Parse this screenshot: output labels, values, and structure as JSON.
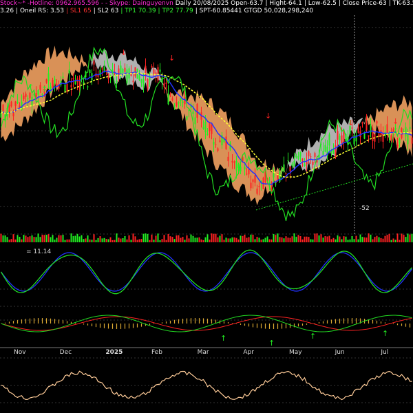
{
  "header": {
    "line1": [
      {
        "text": "Stock~* -Hotline: 0962.965.596 - - Skype: Dainguyenvn",
        "color": "#ff2bd6"
      },
      {
        "text": "Daily 20/08/2025 Open-63.7",
        "color": "#ffffff"
      },
      {
        "text": "| Hight-64.1",
        "color": "#ffffff"
      },
      {
        "text": "| Low-62.5",
        "color": "#ffffff"
      },
      {
        "text": "| Close Price-63",
        "color": "#ffffff"
      },
      {
        "text": "| TK-63.5| KJ-65.15931",
        "color": "#ffffff"
      }
    ],
    "line2": [
      {
        "text": "3.26",
        "color": "#ffffff"
      },
      {
        "text": "| Oneil RS: 3.53",
        "color": "#ffffff"
      },
      {
        "text": "| SL1 65",
        "color": "#ff3030"
      },
      {
        "text": "| SL2 63",
        "color": "#ffffff"
      },
      {
        "text": "| TP1 70.39",
        "color": "#33ff33"
      },
      {
        "text": "| TP2 77.79",
        "color": "#33ff33"
      },
      {
        "text": "| SPT-60.85441 GTGD",
        "color": "#ffffff"
      },
      {
        "text": "50,028,298,240",
        "color": "#ffffff"
      }
    ]
  },
  "colors": {
    "up": "#22ee22",
    "down": "#ff2222",
    "cloud_bull": "#ffaa66",
    "cloud_bear": "#cfcfcf",
    "ma_fast": "#2233ff",
    "ma_slow": "#ffff33",
    "rs_line": "#22dd22",
    "grid": "#333333"
  },
  "chart_data": [
    {
      "type": "candlestick",
      "panel": "price",
      "annotations": [
        {
          "label": "-52"
        }
      ],
      "x": [
        "Nov",
        "Dec",
        "2025",
        "Feb",
        "Mar",
        "Apr",
        "May",
        "Jun",
        "Jul"
      ],
      "close_approx": [
        66,
        70,
        72,
        71,
        64,
        56,
        60,
        63,
        63
      ]
    },
    {
      "type": "bar",
      "panel": "volume"
    },
    {
      "type": "line",
      "panel": "oscillator",
      "legend": "= 11.14",
      "series": [
        {
          "name": "%K"
        },
        {
          "name": "%D"
        }
      ]
    },
    {
      "type": "line",
      "panel": "macd"
    },
    {
      "type": "line",
      "panel": "rsi"
    }
  ],
  "x_axis": {
    "labels": [
      {
        "text": "Nov",
        "bold": false
      },
      {
        "text": "Dec",
        "bold": false
      },
      {
        "text": "2025",
        "bold": true
      },
      {
        "text": "Feb",
        "bold": false
      },
      {
        "text": "Mar",
        "bold": false
      },
      {
        "text": "Apr",
        "bold": false
      },
      {
        "text": "May",
        "bold": false
      },
      {
        "text": "Jun",
        "bold": false
      },
      {
        "text": "Jul",
        "bold": false
      }
    ]
  }
}
